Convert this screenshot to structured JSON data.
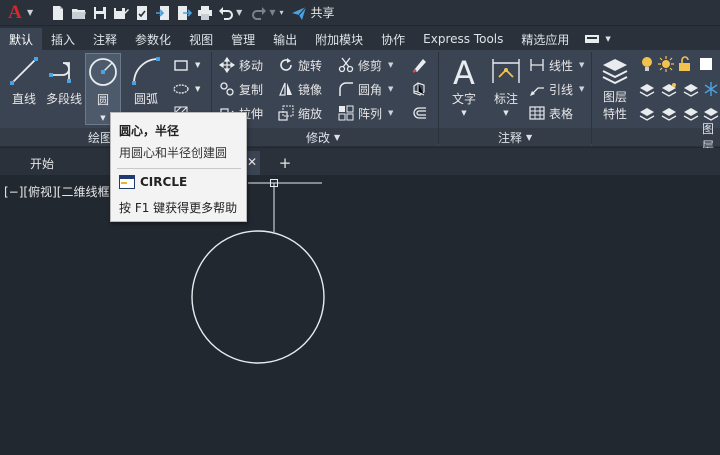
{
  "app": {
    "logo_letter": "A"
  },
  "quick_access": {
    "share_label": "共享"
  },
  "ribbon_tabs": [
    {
      "label": "默认",
      "active": true
    },
    {
      "label": "插入"
    },
    {
      "label": "注释"
    },
    {
      "label": "参数化"
    },
    {
      "label": "视图"
    },
    {
      "label": "管理"
    },
    {
      "label": "输出"
    },
    {
      "label": "附加模块"
    },
    {
      "label": "协作"
    },
    {
      "label": "Express Tools"
    },
    {
      "label": "精选应用"
    }
  ],
  "draw_panel": {
    "title": "绘图",
    "line_label": "直线",
    "polyline_label": "多段线",
    "circle_label": "圆",
    "arc_label": "圆弧"
  },
  "modify_panel": {
    "title": "修改",
    "move": "移动",
    "rotate": "旋转",
    "trim": "修剪",
    "copy": "复制",
    "mirror": "镜像",
    "fillet": "圆角",
    "stretch": "拉伸",
    "scale": "缩放",
    "array": "阵列"
  },
  "annotation_panel": {
    "title": "注释",
    "text_label": "文字",
    "dimension_label": "标注",
    "linear_label": "线性",
    "leader_label": "引线",
    "table_label": "表格"
  },
  "layers_panel": {
    "properties_label_1": "图层",
    "properties_label_2": "特性",
    "title": "图层"
  },
  "file_tabs": {
    "start_label": "开始",
    "add_symbol": "+"
  },
  "viewport": {
    "label": "[−][俯视][二维线框]"
  },
  "tooltip": {
    "title": "圆心，半径",
    "description": "用圆心和半径创建圆",
    "command": "CIRCLE",
    "help": "按 F1 键获得更多帮助"
  },
  "colors": {
    "ribbon_bg": "#3b4453",
    "canvas_bg": "#212830",
    "accent_red": "#d8262b",
    "share_blue": "#4aa3e0"
  }
}
